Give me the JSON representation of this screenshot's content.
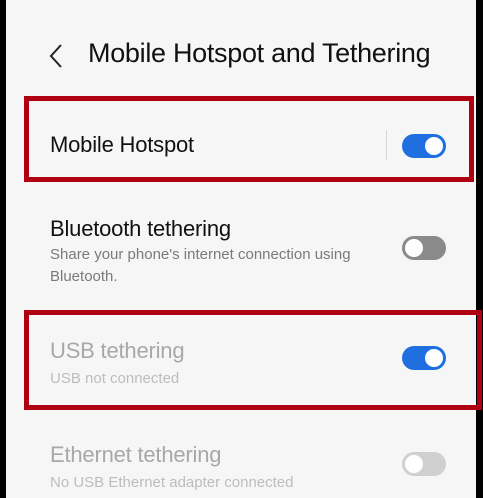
{
  "header": {
    "title": "Mobile Hotspot and Tethering",
    "back_icon": "chevron-left-icon"
  },
  "settings": [
    {
      "title": "Mobile Hotspot",
      "subtitle": "",
      "enabled": true,
      "toggle": "on"
    },
    {
      "title": "Bluetooth tethering",
      "subtitle": "Share your phone's internet connection using Bluetooth.",
      "enabled": true,
      "toggle": "off"
    },
    {
      "title": "USB tethering",
      "subtitle": "USB not connected",
      "enabled": false,
      "toggle": "on"
    },
    {
      "title": "Ethernet tethering",
      "subtitle": "No USB Ethernet adapter connected",
      "enabled": false,
      "toggle": "off"
    }
  ],
  "colors": {
    "accent": "#1f6fe0",
    "highlight": "#b00012",
    "background": "#f6f6f6"
  }
}
